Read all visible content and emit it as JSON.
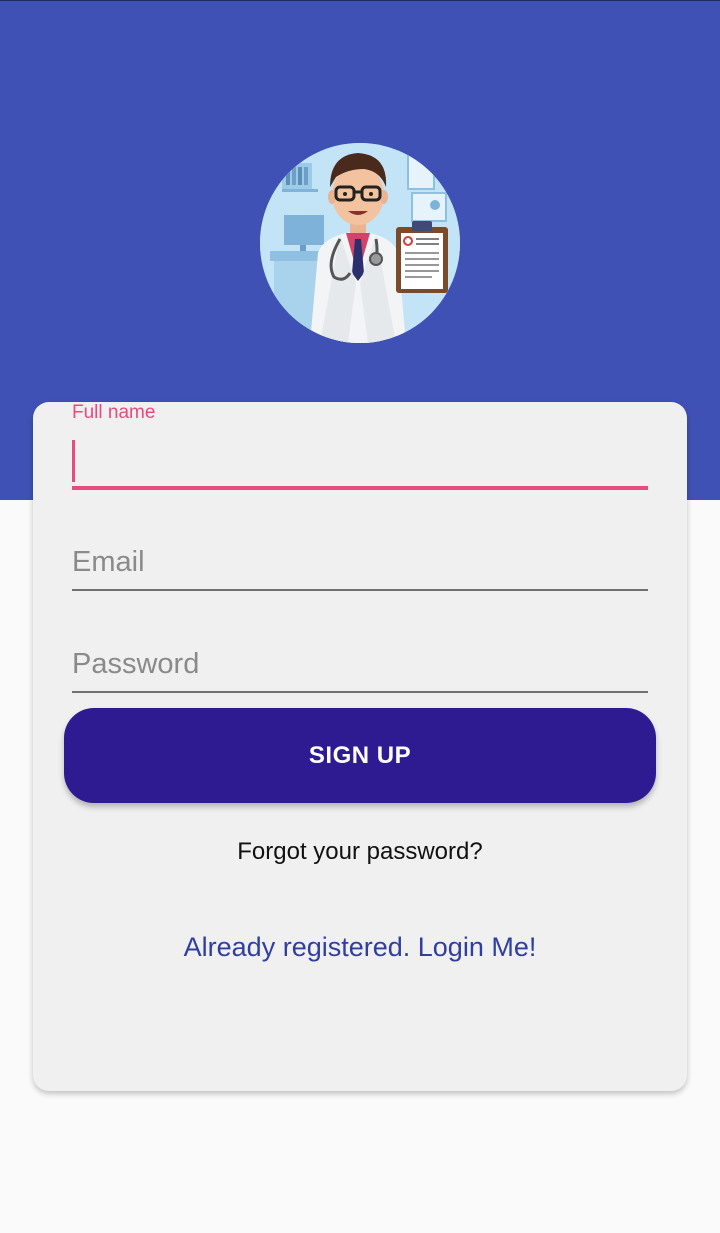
{
  "theme": {
    "header_color": "#3f51b5",
    "accent_color": "#e84a7f",
    "button_color": "#2e1a91",
    "link_color": "#303f9f"
  },
  "header": {
    "avatar_icon": "doctor-illustration"
  },
  "form": {
    "full_name": {
      "label": "Full name",
      "value": ""
    },
    "email": {
      "placeholder": "Email",
      "value": ""
    },
    "password": {
      "placeholder": "Password",
      "value": ""
    },
    "signup_label": "SIGN UP",
    "forgot_label": "Forgot your password?",
    "login_label": "Already registered. Login Me!"
  }
}
